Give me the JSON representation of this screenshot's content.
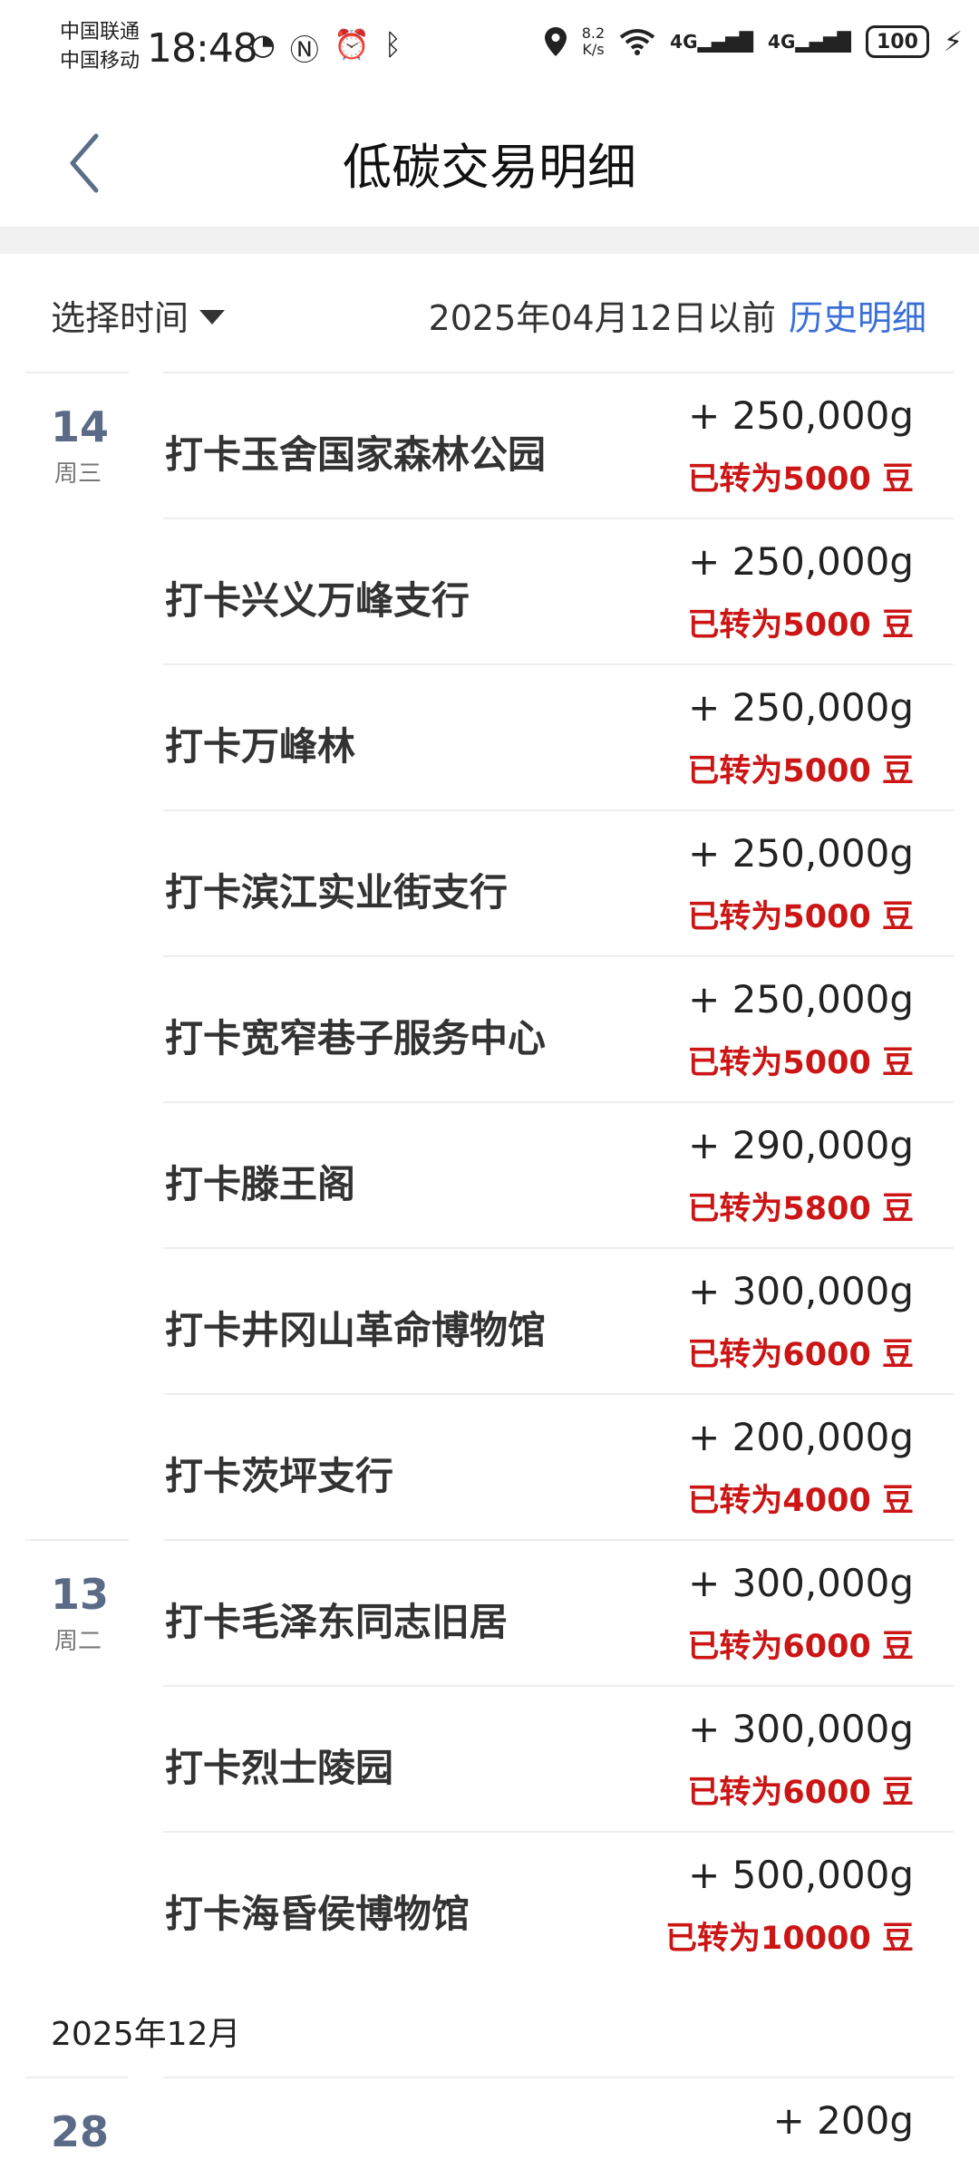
{
  "status_bar": {
    "carrier1": "中国联通",
    "carrier2": "中国移动",
    "time": "18:48",
    "net_speed_value": "8.2",
    "net_speed_unit": "K/s",
    "signal1": "4G",
    "signal2": "4G",
    "battery": "100"
  },
  "header": {
    "title": "低碳交易明细"
  },
  "filter": {
    "select_label": "选择时间",
    "date_text": "2025年04月12日以前",
    "history_link": "历史明细"
  },
  "groups": [
    {
      "day": "14",
      "weekday": "周三",
      "items": [
        {
          "name": "打卡玉舍国家森林公园",
          "amount": "+ 250,000g",
          "converted": "已转为5000 豆"
        },
        {
          "name": "打卡兴义万峰支行",
          "amount": "+ 250,000g",
          "converted": "已转为5000 豆"
        },
        {
          "name": "打卡万峰林",
          "amount": "+ 250,000g",
          "converted": "已转为5000 豆"
        },
        {
          "name": "打卡滨江实业街支行",
          "amount": "+ 250,000g",
          "converted": "已转为5000 豆"
        },
        {
          "name": "打卡宽窄巷子服务中心",
          "amount": "+ 250,000g",
          "converted": "已转为5000 豆"
        },
        {
          "name": "打卡滕王阁",
          "amount": "+ 290,000g",
          "converted": "已转为5800 豆"
        },
        {
          "name": "打卡井冈山革命博物馆",
          "amount": "+ 300,000g",
          "converted": "已转为6000 豆"
        },
        {
          "name": "打卡茨坪支行",
          "amount": "+ 200,000g",
          "converted": "已转为4000 豆"
        }
      ]
    },
    {
      "day": "13",
      "weekday": "周二",
      "items": [
        {
          "name": "打卡毛泽东同志旧居",
          "amount": "+ 300,000g",
          "converted": "已转为6000 豆"
        },
        {
          "name": "打卡烈士陵园",
          "amount": "+ 300,000g",
          "converted": "已转为6000 豆"
        },
        {
          "name": "打卡海昏侯博物馆",
          "amount": "+ 500,000g",
          "converted": "已转为10000 豆"
        }
      ]
    }
  ],
  "month_header": "2025年12月",
  "partial_row": {
    "day": "28",
    "amount": "+ 200g"
  },
  "colors": {
    "accent_link": "#3a6fd8",
    "converted_red": "#cc1515",
    "day_color": "#5b6a86"
  }
}
